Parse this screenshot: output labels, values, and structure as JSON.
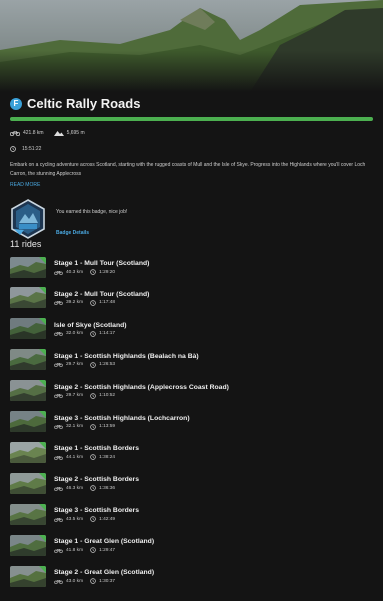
{
  "collection": {
    "badge_letter": "F",
    "title": "Celtic Rally Roads",
    "progress_fraction": 1.0,
    "distance": "421.8 km",
    "elevation": "5,695 m",
    "duration": "15:51:22",
    "description": "Embark on a cycling adventure across Scotland, starting with the rugged coasts of Mull and the Isle of Skye. Progress into the Highlands where you'll cover Loch Carron, the stunning Applecross",
    "read_more": "READ MORE",
    "earned_text": "You earned this badge, nice job!",
    "badge_details": "Badge Details",
    "rides_count": "11 rides"
  },
  "rides": [
    {
      "name": "Stage 1 - Mull Tour (Scotland)",
      "distance": "40.3 km",
      "time": "1:29:20"
    },
    {
      "name": "Stage 2 - Mull Tour (Scotland)",
      "distance": "39.2 km",
      "time": "1:17:48"
    },
    {
      "name": "Isle of Skye (Scotland)",
      "distance": "32.0 km",
      "time": "1:14:17"
    },
    {
      "name": "Stage 1 - Scottish Highlands (Bealach na Bà)",
      "distance": "29.7 km",
      "time": "1:26:53"
    },
    {
      "name": "Stage 2 - Scottish Highlands (Applecross Coast Road)",
      "distance": "29.7 km",
      "time": "1:10:52"
    },
    {
      "name": "Stage 3 - Scottish Highlands (Lochcarron)",
      "distance": "32.1 km",
      "time": "1:13:59"
    },
    {
      "name": "Stage 1 - Scottish Borders",
      "distance": "44.1 km",
      "time": "1:38:24"
    },
    {
      "name": "Stage 2 - Scottish Borders",
      "distance": "46.3 km",
      "time": "1:36:36"
    },
    {
      "name": "Stage 3 - Scottish Borders",
      "distance": "43.5 km",
      "time": "1:42:49"
    },
    {
      "name": "Stage 1 - Great Glen (Scotland)",
      "distance": "41.8 km",
      "time": "1:29:47"
    },
    {
      "name": "Stage 2 - Great Glen (Scotland)",
      "distance": "43.0 km",
      "time": "1:30:37"
    }
  ],
  "colors": {
    "accent_blue": "#4aa8e0",
    "progress_green": "#4cb050",
    "background": "#141414"
  },
  "icons": {
    "distance": "bike-icon",
    "elevation": "mountain-icon",
    "time": "clock-icon"
  }
}
